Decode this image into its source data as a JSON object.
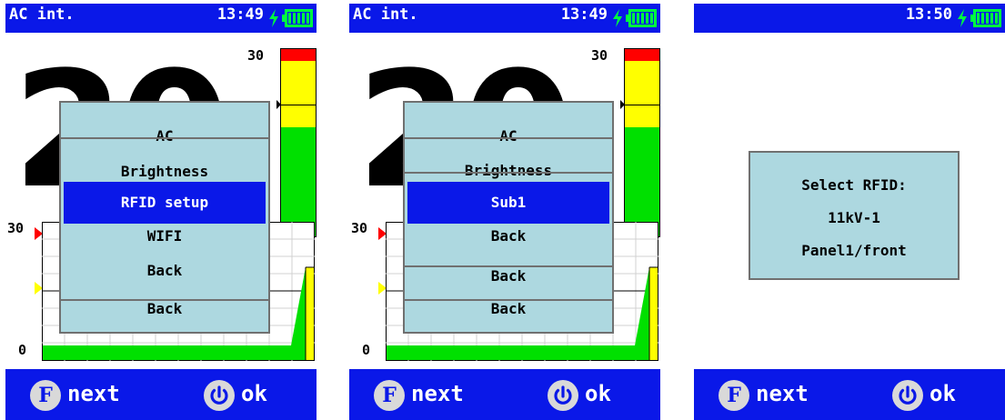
{
  "colors": {
    "bar_blue": "#0a18e8",
    "menu_bg": "#add8e0",
    "menu_border": "#707070",
    "scale_red": "#ff0000",
    "scale_yellow": "#ffff00",
    "scale_green": "#00e000"
  },
  "screens": [
    {
      "status": {
        "title": "AC int.",
        "time": "13:49",
        "icons": [
          "bolt-icon",
          "battery-icon"
        ]
      },
      "reading": "20",
      "scale_max": "30",
      "graph": {
        "y_top": "30",
        "y_bottom": "0"
      },
      "menu": {
        "items": [
          {
            "label": "AC",
            "clipped": true
          },
          {
            "label": "Brightness"
          },
          {
            "label": "RFID setup",
            "selected": true
          },
          {
            "label": "WIFI"
          },
          {
            "label": "Back"
          },
          {
            "label": "Back",
            "clipped": true
          }
        ]
      },
      "bottom": {
        "f_key": "F",
        "f_label": "next",
        "ok_label": "ok",
        "ok_icon": "power-icon"
      }
    },
    {
      "status": {
        "title": "AC int.",
        "time": "13:49",
        "icons": [
          "bolt-icon",
          "battery-icon"
        ]
      },
      "reading": "20",
      "scale_max": "30",
      "graph": {
        "y_top": "30",
        "y_bottom": "0"
      },
      "menu": {
        "items": [
          {
            "label": "AC",
            "clipped": true
          },
          {
            "label": "Brightness",
            "clipped": true
          },
          {
            "label": "Sub1",
            "selected": true
          },
          {
            "label": "Back"
          },
          {
            "label": "Back",
            "clipped": true
          },
          {
            "label": "Back",
            "clipped": true
          }
        ]
      },
      "bottom": {
        "f_key": "F",
        "f_label": "next",
        "ok_label": "ok",
        "ok_icon": "power-icon"
      }
    },
    {
      "status": {
        "title": "",
        "time": "13:50",
        "icons": [
          "bolt-icon",
          "battery-icon"
        ]
      },
      "dialog": {
        "lines": [
          "Select RFID:",
          "11kV-1",
          "Panel1/front"
        ]
      },
      "bottom": {
        "f_key": "F",
        "f_label": "next",
        "ok_label": "ok",
        "ok_icon": "power-icon"
      }
    }
  ]
}
